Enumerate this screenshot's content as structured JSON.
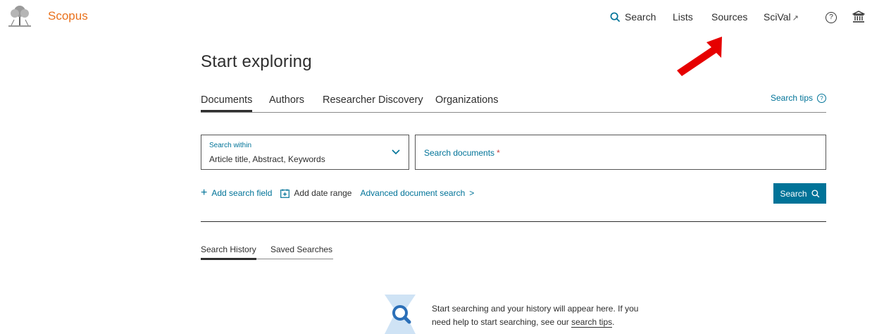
{
  "header": {
    "brand": "Scopus",
    "nav": {
      "search": "Search",
      "lists": "Lists",
      "sources": "Sources",
      "scival": "SciVal",
      "scival_ext": "↗",
      "help": "?"
    }
  },
  "main": {
    "headline": "Start exploring",
    "tabs": [
      "Documents",
      "Authors",
      "Researcher Discovery",
      "Organizations"
    ],
    "active_tab": "Documents",
    "search_tips": "Search tips",
    "search_within": {
      "label": "Search within",
      "value": "Article title, Abstract, Keywords"
    },
    "search_input": {
      "placeholder": "Search documents",
      "required_mark": "*"
    },
    "actions": {
      "add_field": "Add search field",
      "add_date": "Add date range",
      "advanced": "Advanced document search",
      "advanced_chevron": ">"
    },
    "search_button": "Search",
    "history_tabs": [
      "Search History",
      "Saved Searches"
    ],
    "empty_state": {
      "text_before": "Start searching and your history will appear here. If you need help to start searching, see our ",
      "link": "search tips",
      "text_after": "."
    }
  },
  "colors": {
    "brand": "#e9711c",
    "accent": "#007398",
    "annotation_arrow": "#e60000"
  },
  "icons": [
    "search-icon",
    "external-link-icon",
    "help-icon",
    "institution-icon",
    "chevron-down-icon",
    "plus-icon",
    "calendar-icon",
    "chevron-right-icon"
  ]
}
